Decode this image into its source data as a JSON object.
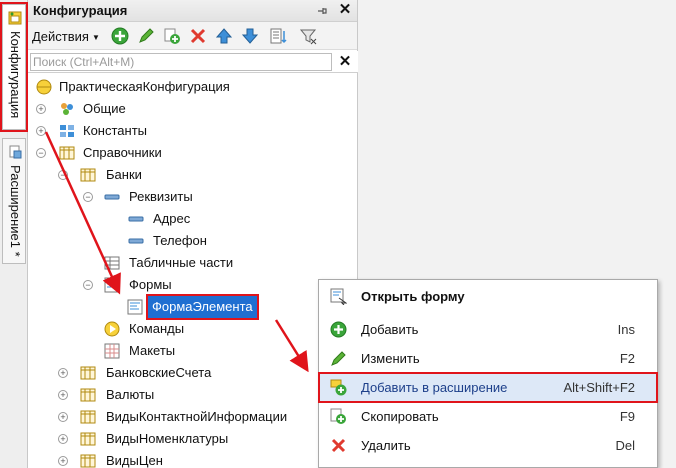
{
  "vertical_tabs": {
    "config_label": "Конфигурация",
    "extension_label": "Расширение1 *"
  },
  "panel": {
    "title": "Конфигурация",
    "actions_label": "Действия",
    "search_placeholder": "Поиск (Ctrl+Alt+M)"
  },
  "toolbar_icons": [
    "add-icon",
    "edit-icon",
    "copy-icon",
    "delete-icon",
    "move-up-icon",
    "move-down-icon",
    "sort-icon",
    "filter-icon"
  ],
  "tree": {
    "root": "ПрактическаяКонфигурация",
    "common": "Общие",
    "constants": "Константы",
    "catalogs": "Справочники",
    "banks": "Банки",
    "requisites": "Реквизиты",
    "address": "Адрес",
    "phone": "Телефон",
    "tabular_parts": "Табличные части",
    "forms": "Формы",
    "element_form": "ФормаЭлемента",
    "commands": "Команды",
    "layouts": "Макеты",
    "bank_accounts": "БанковскиеСчета",
    "currencies": "Валюты",
    "contact_info_types": "ВидыКонтактнойИнформации",
    "nomenclature_types": "ВидыНоменклатуры",
    "price_types": "ВидыЦен"
  },
  "context_menu": {
    "open_form": "Открыть форму",
    "add": "Добавить",
    "add_key": "Ins",
    "edit": "Изменить",
    "edit_key": "F2",
    "add_to_extension": "Добавить в расширение",
    "add_to_extension_key": "Alt+Shift+F2",
    "copy": "Скопировать",
    "copy_key": "F9",
    "delete": "Удалить",
    "delete_key": "Del"
  },
  "colors": {
    "selection": "#1f6fd1",
    "highlight_frame": "#e0141b",
    "menu_hover": "#dde8f7"
  }
}
